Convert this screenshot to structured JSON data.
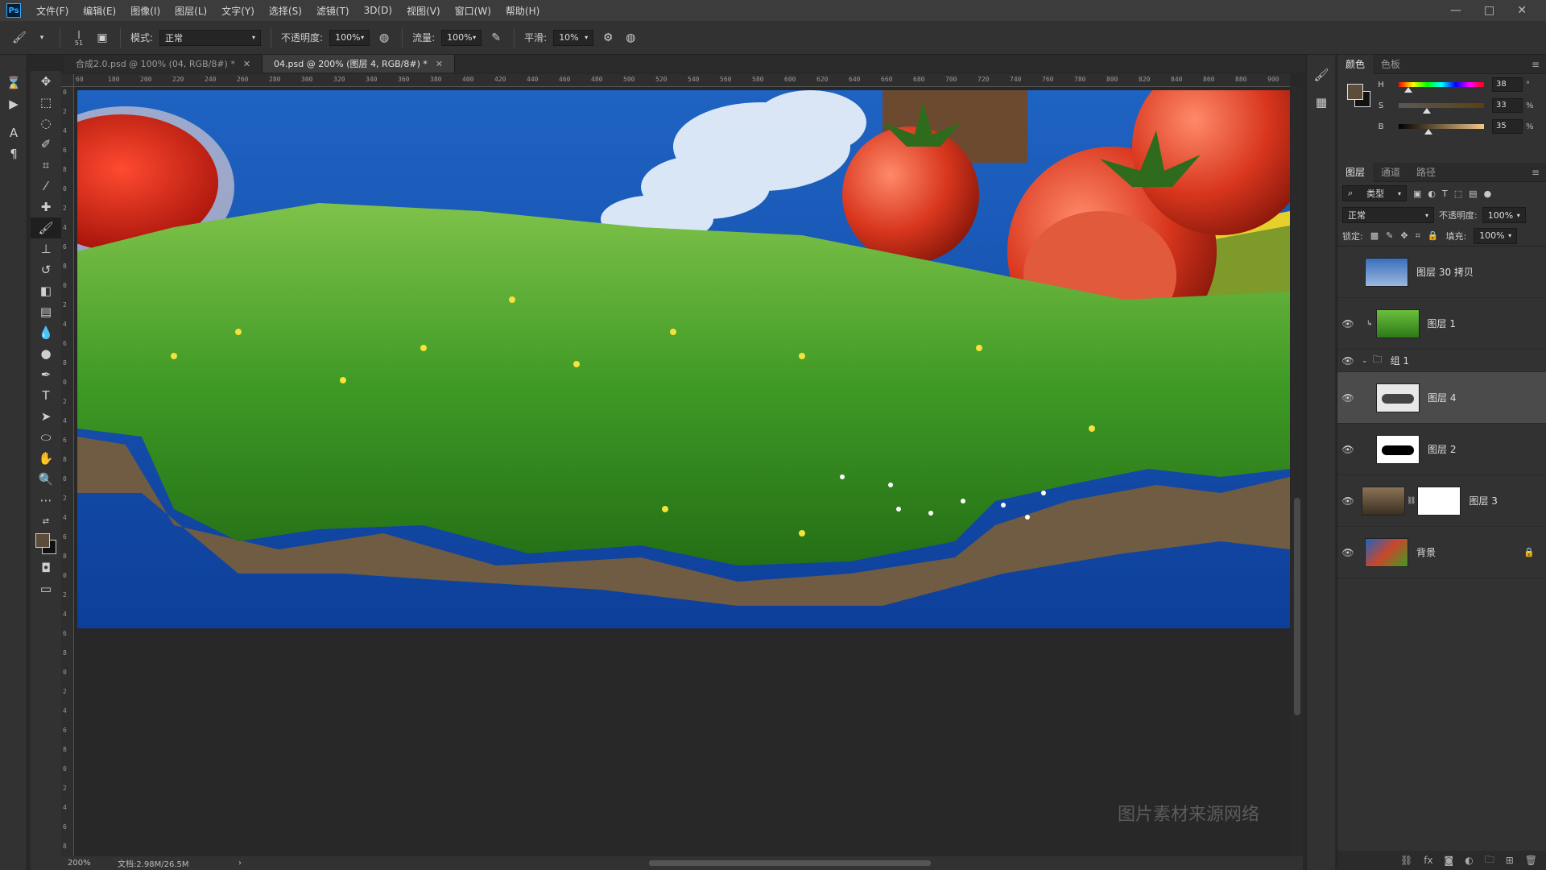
{
  "menu": [
    "文件(F)",
    "编辑(E)",
    "图像(I)",
    "图层(L)",
    "文字(Y)",
    "选择(S)",
    "滤镜(T)",
    "3D(D)",
    "视图(V)",
    "窗口(W)",
    "帮助(H)"
  ],
  "app_logo": "Ps",
  "options": {
    "brush_size": "51",
    "mode_label": "模式:",
    "mode_value": "正常",
    "opacity_label": "不透明度:",
    "opacity_value": "100%",
    "flow_label": "流量:",
    "flow_value": "100%",
    "smooth_label": "平滑:",
    "smooth_value": "10%"
  },
  "tabs": [
    {
      "label": "合成2.0.psd @ 100% (04, RGB/8#) *",
      "active": false
    },
    {
      "label": "04.psd @ 200% (图层 4, RGB/8#) *",
      "active": true
    }
  ],
  "ruler_h": [
    "60",
    "180",
    "200",
    "220",
    "240",
    "260",
    "280",
    "300",
    "320",
    "340",
    "360",
    "380",
    "400",
    "420",
    "440",
    "460",
    "480",
    "500",
    "520",
    "540",
    "560",
    "580",
    "600",
    "620",
    "640",
    "660",
    "680",
    "700",
    "720",
    "740",
    "760",
    "780",
    "800",
    "820",
    "840",
    "860",
    "880",
    "900"
  ],
  "ruler_v": [
    "0",
    "2",
    "4",
    "6",
    "8",
    "0",
    "2",
    "4",
    "6",
    "8",
    "0",
    "2",
    "4",
    "6",
    "8",
    "0",
    "2",
    "4",
    "6",
    "8",
    "0",
    "2",
    "4",
    "6",
    "8",
    "0",
    "2",
    "4",
    "6",
    "8",
    "0",
    "2",
    "4",
    "6",
    "8",
    "0",
    "2",
    "4",
    "6",
    "8"
  ],
  "watermark": "图片素材来源网络",
  "status": {
    "zoom": "200%",
    "doc": "文档:2.98M/26.5M"
  },
  "color_panel": {
    "tabs": [
      "颜色",
      "色板"
    ],
    "h_label": "H",
    "h_value": "38",
    "h_unit": "°",
    "s_label": "S",
    "s_value": "33",
    "s_unit": "%",
    "b_label": "B",
    "b_value": "35",
    "b_unit": "%",
    "h_level": 0.11,
    "s_level": 0.33,
    "b_level": 0.35
  },
  "layers_panel": {
    "tabs": [
      "图层",
      "通道",
      "路径"
    ],
    "filter": "类型",
    "blend_mode": "正常",
    "opacity_label": "不透明度:",
    "opacity_value": "100%",
    "lock_label": "锁定:",
    "fill_label": "填充:",
    "fill_value": "100%",
    "layers": [
      {
        "name": "图层 30 拷贝",
        "visible": false
      },
      {
        "name": "图层 1",
        "visible": true
      },
      {
        "name": "组 1",
        "visible": true,
        "group": true
      },
      {
        "name": "图层 4",
        "visible": true,
        "selected": true
      },
      {
        "name": "图层 2",
        "visible": true
      },
      {
        "name": "图层 3",
        "visible": true
      },
      {
        "name": "背景",
        "visible": true,
        "locked": true
      }
    ]
  },
  "colors": {
    "sky": "#1a5fc0",
    "grass": "#3d9a22",
    "soil": "#6f5c42",
    "tomato": "#d8361d"
  }
}
